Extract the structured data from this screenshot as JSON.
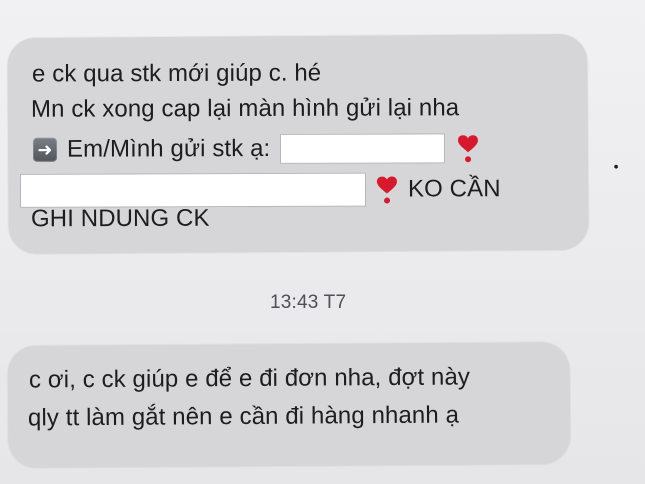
{
  "messages": [
    {
      "lines": [
        "e ck qua stk mới giúp c. hé",
        "Mn ck xong cap lại màn hình gửi lại nha",
        "Em/Mình gửi stk ạ:",
        "KO CẦN",
        "GHI NDUNG CK"
      ]
    },
    {
      "lines": [
        "c ơi, c ck giúp e để e đi đơn nha, đợt này",
        "qly tt làm gắt nên e cần đi hàng nhanh ạ"
      ]
    }
  ],
  "timestamp": "13:43 T7",
  "icons": {
    "arrow": "arrow-right-icon",
    "heart": "heart-exclamation-icon"
  },
  "colors": {
    "bubble": "#d6d6d9",
    "background": "#efeff1",
    "heart": "#d7192e"
  }
}
